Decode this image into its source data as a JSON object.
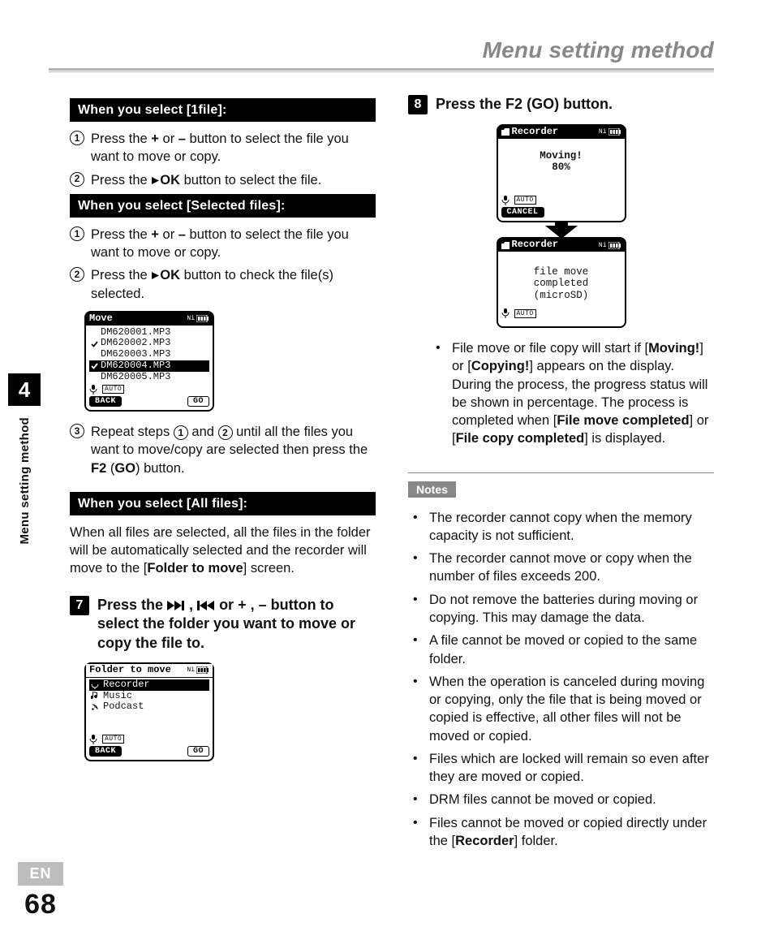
{
  "header": {
    "title": "Menu setting method"
  },
  "sidetab": {
    "chapter": "4",
    "title": "Menu setting method"
  },
  "footer": {
    "lang": "EN",
    "page": "68"
  },
  "left": {
    "bar1": "When you select [1file]:",
    "s1_1a": "Press the ",
    "s1_1b": " or ",
    "s1_1c": " button to select the file you want to move or copy.",
    "plus": "+",
    "minus": "–",
    "s1_2a": "Press the ",
    "s1_2b": "OK",
    "s1_2c": " button to select the file.",
    "bar2": "When you select [Selected files]:",
    "s2_1a": "Press the ",
    "s2_1b": " or ",
    "s2_1c": " button to select the file you want to move or copy.",
    "s2_2a": "Press the ",
    "s2_2b": "OK",
    "s2_2c": " button to check the file(s) selected.",
    "lcd_move": {
      "title": "Move",
      "files": [
        "DM620001.MP3",
        "DM620002.MP3",
        "DM620003.MP3",
        "DM620004.MP3",
        "DM620005.MP3"
      ],
      "checked": [
        1,
        3
      ],
      "selected": 3,
      "back": "BACK",
      "go": "GO",
      "auto": "AUTO"
    },
    "s2_3a": "Repeat steps ",
    "s2_3b": " and ",
    "s2_3c": " until all the files you want to move/copy are selected then press the ",
    "s2_3d": " (",
    "s2_3e": ") button.",
    "f2": "F2",
    "go": "GO",
    "one": "1",
    "two": "2",
    "bar3": "When you select [All files]:",
    "allfiles_a": "When all files are selected, all the files in the folder will be automatically selected and the recorder will move to the [",
    "allfiles_b": "Folder to move",
    "allfiles_c": "] screen.",
    "step7": {
      "num": "7",
      "a": "Press the ",
      "b": " , ",
      "c": " or + , – button to select the folder you want to move or copy the file to."
    },
    "lcd_folder": {
      "title": "Folder to move",
      "items": [
        "Recorder",
        "Music",
        "Podcast"
      ],
      "selected": 0,
      "back": "BACK",
      "go": "GO",
      "auto": "AUTO"
    }
  },
  "right": {
    "step8": {
      "num": "8",
      "a": "Press the ",
      "f2": "F2",
      "b": " (",
      "go": "GO",
      "c": ") button."
    },
    "lcd_moving": {
      "title": "Recorder",
      "l1": "Moving!",
      "l2": "80%",
      "cancel": "CANCEL",
      "auto": "AUTO"
    },
    "lcd_done": {
      "title": "Recorder",
      "l1": "file move",
      "l2": "completed",
      "l3": "(microSD)",
      "auto": "AUTO"
    },
    "para": {
      "a": "File move or file copy will start if [",
      "m": "Moving!",
      "b": "] or [",
      "c": "Copying!",
      "d": "] appears on the display. During the process, the progress status will be shown in percentage. The process is completed when [",
      "e": "File move completed",
      "f": "] or [",
      "g": "File copy completed",
      "h": "] is displayed."
    },
    "notes_label": "Notes",
    "notes": [
      "The recorder cannot copy when the memory capacity is not sufficient.",
      "The recorder cannot move or copy when the number of files exceeds 200.",
      "Do not remove the batteries during moving or copying. This may damage the data.",
      "A file cannot be moved or copied to the same folder.",
      "When the operation is canceled during moving or copying, only the file that is being moved or copied is effective, all other files will not be moved or copied.",
      "Files which are locked will remain so even after they are moved or copied.",
      "DRM files cannot be moved or copied."
    ],
    "note_last_a": "Files cannot be moved or copied directly under the [",
    "note_last_b": "Recorder",
    "note_last_c": "] folder."
  },
  "icons": {
    "ni": "Ni"
  }
}
